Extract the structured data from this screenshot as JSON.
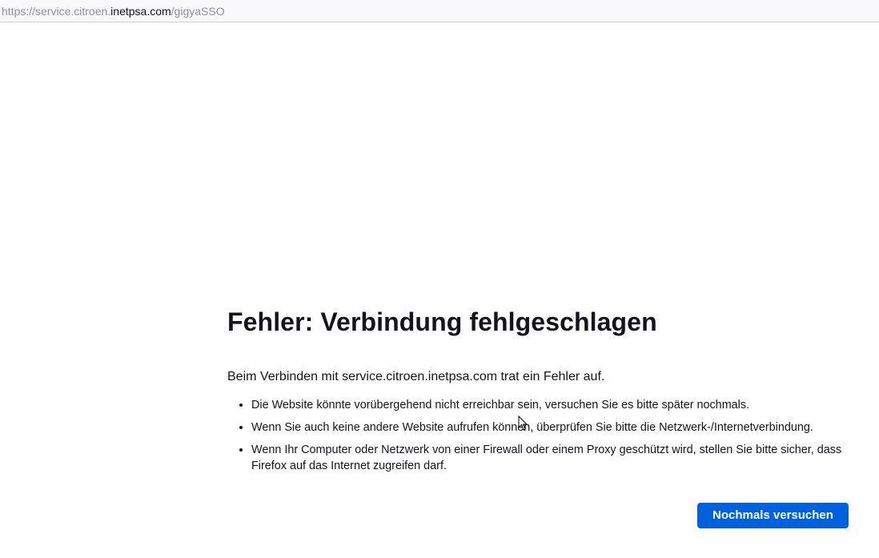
{
  "address_bar": {
    "prefix": "https://service.citroen.",
    "host": "inetpsa.com",
    "path": "/gigyaSSO"
  },
  "error_page": {
    "title": "Fehler: Verbindung fehlgeschlagen",
    "intro": "Beim Verbinden mit service.citroen.inetpsa.com trat ein Fehler auf.",
    "hints": [
      "Die Website könnte vorübergehend nicht erreichbar sein, versuchen Sie es bitte später nochmals.",
      "Wenn Sie auch keine andere Website aufrufen können, überprüfen Sie bitte die Netzwerk-/Internetverbindung.",
      "Wenn Ihr Computer oder Netzwerk von einer Firewall oder einem Proxy geschützt wird, stellen Sie bitte sicher, dass Firefox auf das Internet zugreifen darf."
    ],
    "retry_label": "Nochmals versuchen"
  },
  "colors": {
    "accent": "#0061e0",
    "text": "#15141a",
    "url_dim": "#8f8f9d"
  }
}
